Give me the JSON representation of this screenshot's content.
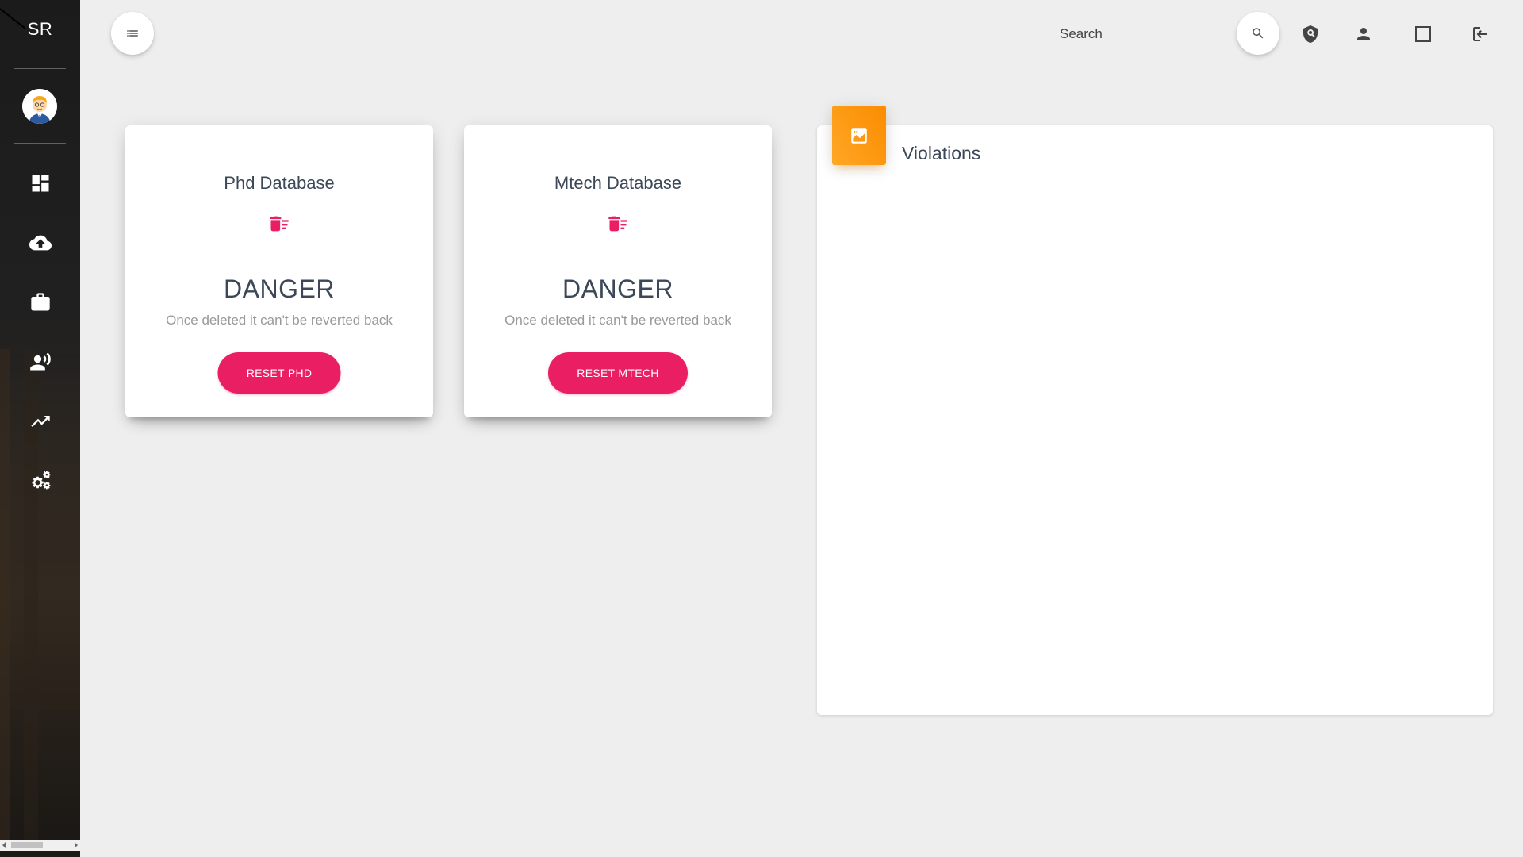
{
  "sidebar": {
    "brand": "SR",
    "items": [
      {
        "name": "dashboard-icon"
      },
      {
        "name": "cloud-upload-icon"
      },
      {
        "name": "briefcase-icon"
      },
      {
        "name": "speaker-person-icon"
      },
      {
        "name": "trending-up-icon"
      },
      {
        "name": "settings-gears-icon"
      }
    ]
  },
  "topbar": {
    "search_placeholder": "Search",
    "icons": [
      "menu-list-icon",
      "search-icon",
      "shield-icon",
      "person-icon",
      "square-icon",
      "logout-icon"
    ]
  },
  "cards": [
    {
      "title": "Phd Database",
      "heading": "DANGER",
      "description": "Once deleted it can't be reverted back",
      "button": "RESET PHD"
    },
    {
      "title": "Mtech Database",
      "heading": "DANGER",
      "description": "Once deleted it can't be reverted back",
      "button": "RESET MTECH"
    }
  ],
  "violations": {
    "title": "Violations"
  },
  "colors": {
    "accent_pink": "#e91e63",
    "accent_orange": "#fb8c00",
    "background": "#eeeeee"
  }
}
